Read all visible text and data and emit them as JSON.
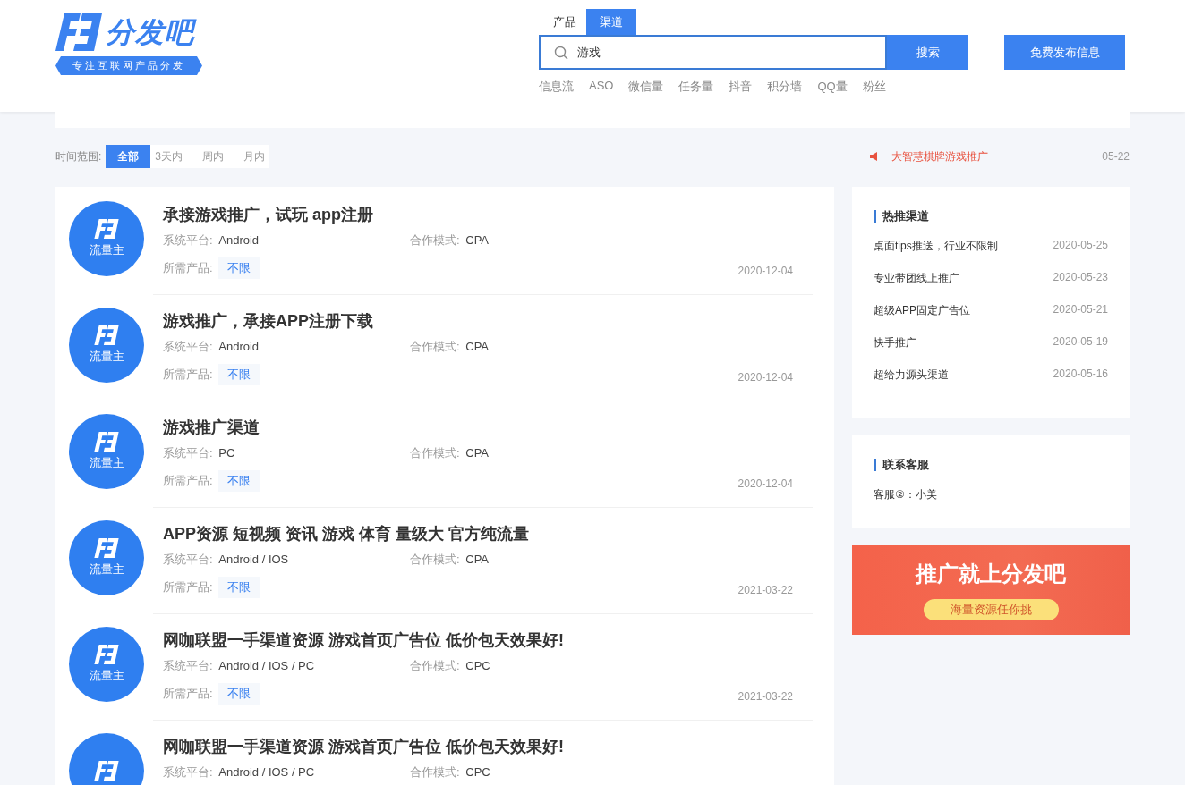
{
  "header": {
    "logo": {
      "name": "分发吧",
      "slogan": "专注互联网产品分发"
    },
    "search_tabs": [
      {
        "label": "产品",
        "selected": false
      },
      {
        "label": "渠道",
        "selected": true
      }
    ],
    "search": {
      "value": "游戏",
      "button": "搜索"
    },
    "hot_tags": [
      "信息流",
      "ASO",
      "微信量",
      "任务量",
      "抖音",
      "积分墙",
      "QQ量",
      "粉丝"
    ],
    "publish_button": "免费发布信息"
  },
  "filter": {
    "label": "时间范围:",
    "options": [
      {
        "label": "全部",
        "selected": true
      },
      {
        "label": "3天内",
        "selected": false
      },
      {
        "label": "一周内",
        "selected": false
      },
      {
        "label": "一月内",
        "selected": false
      }
    ]
  },
  "notice": {
    "text": "大智慧棋牌游戏推广",
    "date": "05-22"
  },
  "listings": [
    {
      "badge": "流量主",
      "title": "承接游戏推广，试玩 app注册",
      "platform_label": "系统平台:",
      "platform": "Android",
      "mode_label": "合作模式:",
      "mode": "CPA",
      "product_label": "所需产品:",
      "product": "不限",
      "date": "2020-12-04"
    },
    {
      "badge": "流量主",
      "title": "游戏推广，承接APP注册下载",
      "platform_label": "系统平台:",
      "platform": "Android",
      "mode_label": "合作模式:",
      "mode": "CPA",
      "product_label": "所需产品:",
      "product": "不限",
      "date": "2020-12-04"
    },
    {
      "badge": "流量主",
      "title": "游戏推广渠道",
      "platform_label": "系统平台:",
      "platform": "PC",
      "mode_label": "合作模式:",
      "mode": "CPA",
      "product_label": "所需产品:",
      "product": "不限",
      "date": "2020-12-04"
    },
    {
      "badge": "流量主",
      "title": "APP资源 短视频 资讯 游戏 体育 量级大 官方纯流量",
      "platform_label": "系统平台:",
      "platform": "Android / IOS",
      "mode_label": "合作模式:",
      "mode": "CPA",
      "product_label": "所需产品:",
      "product": "不限",
      "date": "2021-03-22"
    },
    {
      "badge": "流量主",
      "title": "网咖联盟一手渠道资源 游戏首页广告位 低价包天效果好!",
      "platform_label": "系统平台:",
      "platform": "Android / IOS / PC",
      "mode_label": "合作模式:",
      "mode": "CPC",
      "product_label": "所需产品:",
      "product": "不限",
      "date": "2021-03-22"
    },
    {
      "title": "网咖联盟一手渠道资源 游戏首页广告位 低价包天效果好!",
      "platform_label": "系统平台:",
      "platform": "Android / IOS / PC",
      "mode_label": "合作模式:",
      "mode": "CPC"
    }
  ],
  "sidebar": {
    "hot": {
      "title": "热推渠道",
      "items": [
        {
          "text": "桌面tips推送，行业不限制",
          "date": "2020-05-25"
        },
        {
          "text": "专业带团线上推广",
          "date": "2020-05-23"
        },
        {
          "text": "超级APP固定广告位",
          "date": "2020-05-21"
        },
        {
          "text": "快手推广",
          "date": "2020-05-19"
        },
        {
          "text": "超给力源头渠道",
          "date": "2020-05-16"
        }
      ]
    },
    "contact": {
      "title": "联系客服",
      "text": "客服②：小美"
    },
    "banner": {
      "headline": "推广就上分发吧",
      "tagline": "海量资源任你挑"
    }
  }
}
